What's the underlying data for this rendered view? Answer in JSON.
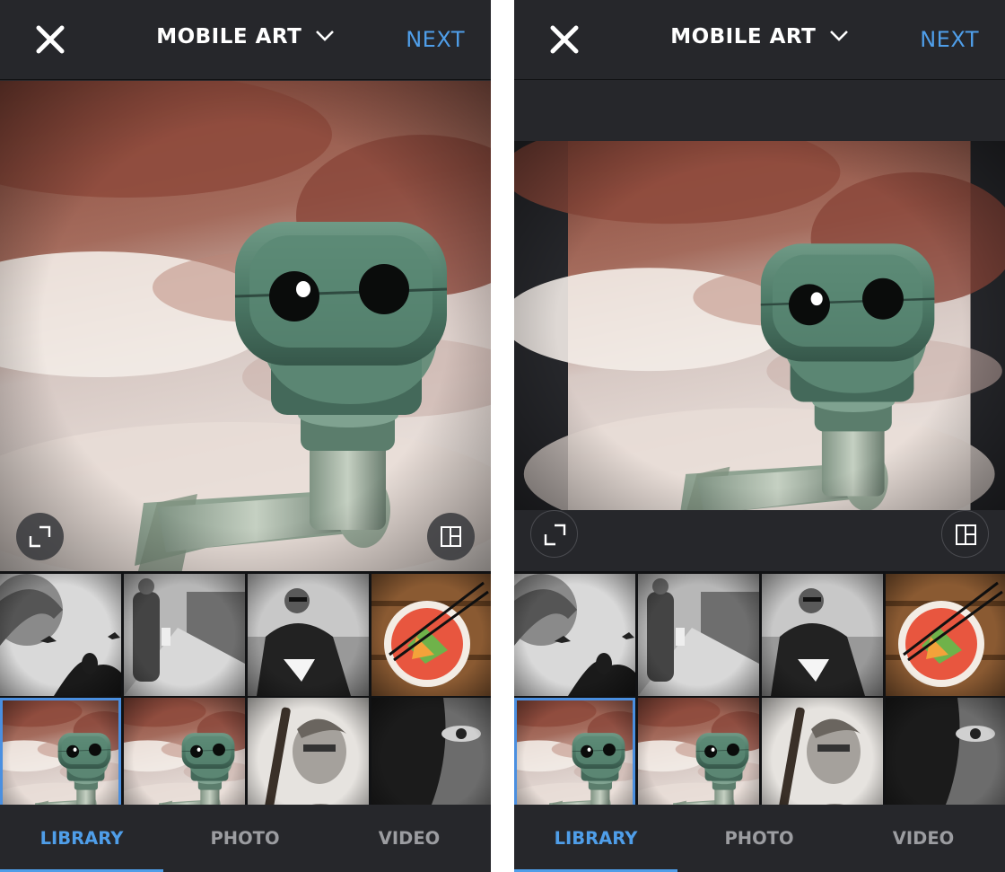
{
  "screens": [
    {
      "header": {
        "title": "MOBILE ART",
        "next_label": "NEXT"
      },
      "tabs": [
        {
          "label": "LIBRARY",
          "active": true
        },
        {
          "label": "PHOTO"
        },
        {
          "label": "VIDEO"
        }
      ],
      "selected_thumbnail": 4,
      "preview_mode": "fill"
    },
    {
      "header": {
        "title": "MOBILE ART",
        "next_label": "NEXT"
      },
      "tabs": [
        {
          "label": "LIBRARY",
          "active": true
        },
        {
          "label": "PHOTO"
        },
        {
          "label": "VIDEO"
        }
      ],
      "selected_thumbnail": 4,
      "preview_mode": "fit"
    }
  ],
  "thumbnails": [
    {
      "name": "pigeons-silhouette"
    },
    {
      "name": "street-man-sidewalk"
    },
    {
      "name": "man-sunglasses-chair"
    },
    {
      "name": "food-bowl-chopsticks"
    },
    {
      "name": "binocular-viewer"
    },
    {
      "name": "binocular-viewer-alt"
    },
    {
      "name": "boy-holding-stick"
    },
    {
      "name": "face-closeup-dark"
    }
  ],
  "icons": {
    "close": "close-icon",
    "title_dropdown": "chevron-down-icon",
    "expand": "expand-icon",
    "layout": "layout-icon"
  },
  "colors": {
    "accent": "#4f9ee9",
    "background": "#26272b",
    "text": "#ffffff",
    "inactive_tab": "#9c9da1",
    "selection": "#4a8fe0"
  }
}
